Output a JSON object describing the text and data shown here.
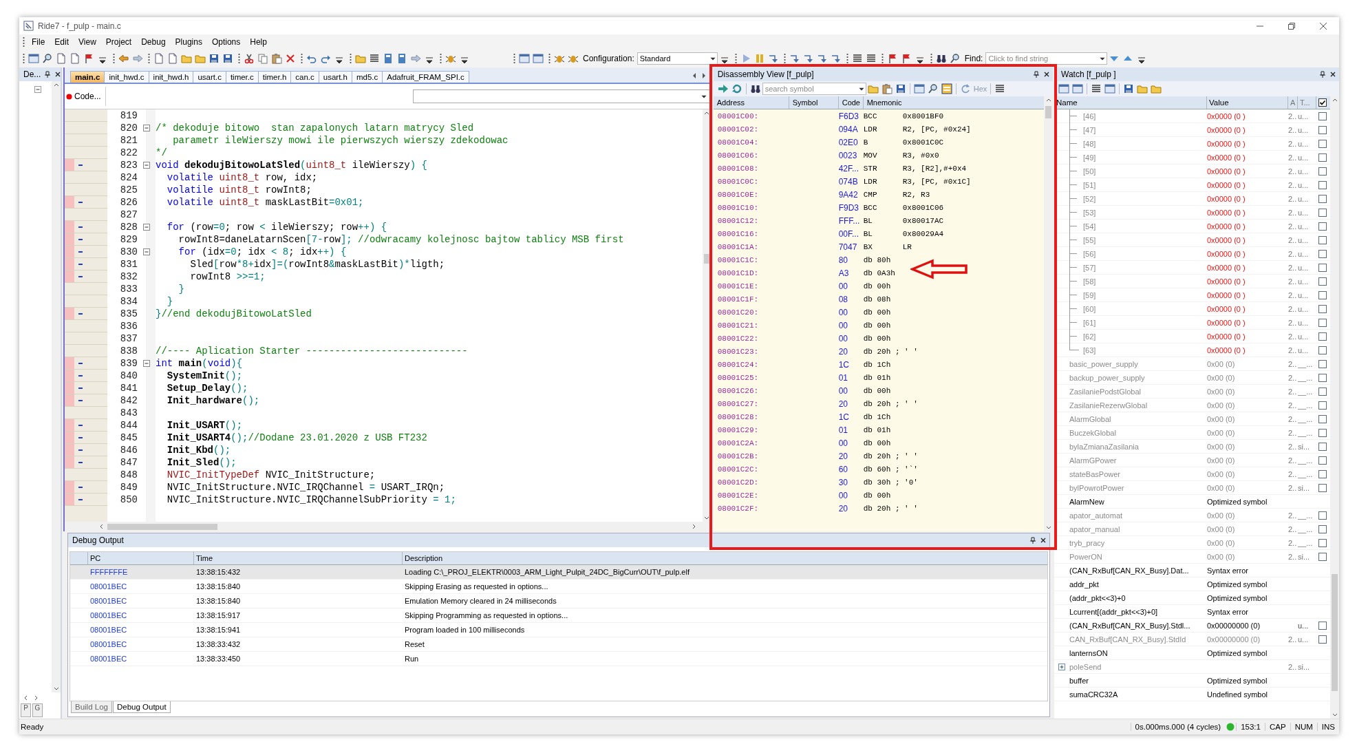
{
  "window": {
    "title": "Ride7 - f_pulp - main.c"
  },
  "menu": [
    "File",
    "Edit",
    "View",
    "Project",
    "Debug",
    "Plugins",
    "Options",
    "Help"
  ],
  "toolbar": {
    "configuration_label": "Configuration:",
    "configuration": "Standard",
    "find_label": "Find:",
    "find_placeholder": "Click to find string"
  },
  "left_panel": {
    "title": "De...",
    "tabs": [
      "P",
      "G"
    ]
  },
  "editor": {
    "tabs": [
      {
        "label": "main.c",
        "selected": true
      },
      {
        "label": "init_hwd.c",
        "selected": false
      },
      {
        "label": "init_hwd.h",
        "selected": false
      },
      {
        "label": "usart.c",
        "selected": false
      },
      {
        "label": "timer.c",
        "selected": false
      },
      {
        "label": "timer.h",
        "selected": false
      },
      {
        "label": "can.c",
        "selected": false
      },
      {
        "label": "usart.h",
        "selected": false
      },
      {
        "label": "md5.c",
        "selected": false
      },
      {
        "label": "Adafruit_FRAM_SPI.c",
        "selected": false
      }
    ],
    "code_button": "Code...",
    "lines": [
      {
        "n": "819",
        "fold": false,
        "exec": false
      },
      {
        "n": "820",
        "fold": true,
        "exec": false,
        "t": [
          {
            "kind": "comment",
            "text": "/* dekoduje bitowo  stan zapalonych latarn matrycy Sled"
          }
        ]
      },
      {
        "n": "821",
        "fold": false,
        "exec": false,
        "t": [
          {
            "kind": "comment",
            "text": "   parametr ileWierszy mowi ile pierwszych wierszy zdekodowac"
          }
        ]
      },
      {
        "n": "822",
        "fold": false,
        "exec": false,
        "t": [
          {
            "kind": "comment",
            "text": "*/"
          }
        ]
      },
      {
        "n": "823",
        "fold": true,
        "exec": true,
        "t": [
          {
            "kind": "keyword",
            "text": "void "
          },
          {
            "kind": "function",
            "text": "dekodujBitowoLatSled"
          },
          {
            "kind": "operator",
            "text": "("
          },
          {
            "kind": "type",
            "text": "uint8_t"
          },
          {
            "kind": "plain",
            "text": " ileWierszy"
          },
          {
            "kind": "operator",
            "text": ") {"
          }
        ]
      },
      {
        "n": "824",
        "fold": false,
        "exec": false,
        "t": [
          {
            "kind": "keyword",
            "text": "  volatile "
          },
          {
            "kind": "type",
            "text": "uint8_t"
          },
          {
            "kind": "plain",
            "text": " row, idx;"
          }
        ]
      },
      {
        "n": "825",
        "fold": false,
        "exec": false,
        "t": [
          {
            "kind": "keyword",
            "text": "  volatile "
          },
          {
            "kind": "type",
            "text": "uint8_t"
          },
          {
            "kind": "plain",
            "text": " rowInt8;"
          }
        ]
      },
      {
        "n": "826",
        "fold": false,
        "exec": true,
        "t": [
          {
            "kind": "keyword",
            "text": "  volatile "
          },
          {
            "kind": "type",
            "text": "uint8_t"
          },
          {
            "kind": "plain",
            "text": " maskLastBit"
          },
          {
            "kind": "operator",
            "text": "=0x01;"
          }
        ]
      },
      {
        "n": "827",
        "fold": false,
        "exec": false
      },
      {
        "n": "828",
        "fold": true,
        "exec": true,
        "t": [
          {
            "kind": "keyword",
            "text": "  for"
          },
          {
            "kind": "plain",
            "text": " (row"
          },
          {
            "kind": "operator",
            "text": "=0"
          },
          {
            "kind": "plain",
            "text": "; row "
          },
          {
            "kind": "operator",
            "text": "<"
          },
          {
            "kind": "plain",
            "text": " ileWierszy; row"
          },
          {
            "kind": "operator",
            "text": "++) {"
          }
        ]
      },
      {
        "n": "829",
        "fold": false,
        "exec": true,
        "t": [
          {
            "kind": "plain",
            "text": "    rowInt8=daneLatarnScen"
          },
          {
            "kind": "operator",
            "text": "[7-"
          },
          {
            "kind": "plain",
            "text": "row"
          },
          {
            "kind": "operator",
            "text": "];"
          },
          {
            "kind": "comment",
            "text": " //odwracamy kolejnosc bajtow tablicy MSB first"
          }
        ]
      },
      {
        "n": "830",
        "fold": true,
        "exec": true,
        "t": [
          {
            "kind": "keyword",
            "text": "    for"
          },
          {
            "kind": "plain",
            "text": " (idx"
          },
          {
            "kind": "operator",
            "text": "=0"
          },
          {
            "kind": "plain",
            "text": "; idx "
          },
          {
            "kind": "operator",
            "text": "< 8"
          },
          {
            "kind": "plain",
            "text": "; idx"
          },
          {
            "kind": "operator",
            "text": "++) {"
          }
        ]
      },
      {
        "n": "831",
        "fold": false,
        "exec": true,
        "t": [
          {
            "kind": "plain",
            "text": "      Sled"
          },
          {
            "kind": "operator",
            "text": "["
          },
          {
            "kind": "plain",
            "text": "row"
          },
          {
            "kind": "operator",
            "text": "*8+"
          },
          {
            "kind": "plain",
            "text": "idx"
          },
          {
            "kind": "operator",
            "text": "]=("
          },
          {
            "kind": "plain",
            "text": "rowInt8"
          },
          {
            "kind": "operator",
            "text": "&"
          },
          {
            "kind": "plain",
            "text": "maskLastBit"
          },
          {
            "kind": "operator",
            "text": ")*"
          },
          {
            "kind": "plain",
            "text": "ligth;"
          }
        ]
      },
      {
        "n": "832",
        "fold": false,
        "exec": true,
        "t": [
          {
            "kind": "plain",
            "text": "      rowInt8 "
          },
          {
            "kind": "operator",
            "text": ">>=1;"
          }
        ]
      },
      {
        "n": "833",
        "fold": false,
        "exec": false,
        "t": [
          {
            "kind": "operator",
            "text": "    }"
          }
        ]
      },
      {
        "n": "834",
        "fold": false,
        "exec": false,
        "t": [
          {
            "kind": "operator",
            "text": "  }"
          }
        ]
      },
      {
        "n": "835",
        "fold": false,
        "exec": true,
        "t": [
          {
            "kind": "operator",
            "text": "}"
          },
          {
            "kind": "comment",
            "text": "//end dekodujBitowoLatSled"
          }
        ]
      },
      {
        "n": "836",
        "fold": false,
        "exec": false
      },
      {
        "n": "837",
        "fold": false,
        "exec": false
      },
      {
        "n": "838",
        "fold": false,
        "exec": false,
        "t": [
          {
            "kind": "comment",
            "text": "//---- Aplication Starter ----------------------------"
          }
        ]
      },
      {
        "n": "839",
        "fold": true,
        "exec": true,
        "t": [
          {
            "kind": "keyword",
            "text": "int "
          },
          {
            "kind": "function",
            "text": "main"
          },
          {
            "kind": "operator",
            "text": "("
          },
          {
            "kind": "keyword",
            "text": "void"
          },
          {
            "kind": "operator",
            "text": "){"
          }
        ]
      },
      {
        "n": "840",
        "fold": false,
        "exec": true,
        "t": [
          {
            "kind": "function",
            "text": "  SystemInit"
          },
          {
            "kind": "operator",
            "text": "();"
          }
        ]
      },
      {
        "n": "841",
        "fold": false,
        "exec": true,
        "t": [
          {
            "kind": "function",
            "text": "  Setup_Delay"
          },
          {
            "kind": "operator",
            "text": "();"
          }
        ]
      },
      {
        "n": "842",
        "fold": false,
        "exec": true,
        "t": [
          {
            "kind": "function",
            "text": "  Init_hardware"
          },
          {
            "kind": "operator",
            "text": "();"
          }
        ]
      },
      {
        "n": "843",
        "fold": false,
        "exec": false
      },
      {
        "n": "844",
        "fold": false,
        "exec": true,
        "t": [
          {
            "kind": "function",
            "text": "  Init_USART"
          },
          {
            "kind": "operator",
            "text": "();"
          }
        ]
      },
      {
        "n": "845",
        "fold": false,
        "exec": true,
        "t": [
          {
            "kind": "function",
            "text": "  Init_USART4"
          },
          {
            "kind": "operator",
            "text": "();"
          },
          {
            "kind": "comment",
            "text": "//Dodane 23.01.2020 z USB FT232"
          }
        ]
      },
      {
        "n": "846",
        "fold": false,
        "exec": true,
        "t": [
          {
            "kind": "function",
            "text": "  Init_Kbd"
          },
          {
            "kind": "operator",
            "text": "();"
          }
        ]
      },
      {
        "n": "847",
        "fold": false,
        "exec": true,
        "t": [
          {
            "kind": "function",
            "text": "  Init_Sled"
          },
          {
            "kind": "operator",
            "text": "();"
          }
        ]
      },
      {
        "n": "848",
        "fold": false,
        "exec": false,
        "t": [
          {
            "kind": "type",
            "text": "  NVIC_InitTypeDef"
          },
          {
            "kind": "plain",
            "text": " NVIC_InitStructure;"
          }
        ]
      },
      {
        "n": "849",
        "fold": false,
        "exec": true,
        "t": [
          {
            "kind": "plain",
            "text": "  NVIC_InitStructure.NVIC_IRQChannel "
          },
          {
            "kind": "operator",
            "text": "="
          },
          {
            "kind": "plain",
            "text": " USART_IRQn;"
          }
        ]
      },
      {
        "n": "850",
        "fold": false,
        "exec": true,
        "t": [
          {
            "kind": "plain",
            "text": "  NVIC_InitStructure.NVIC_IRQChannelSubPriority "
          },
          {
            "kind": "operator",
            "text": "= 1;"
          }
        ]
      }
    ]
  },
  "disassembly": {
    "title": "Disassembly View [f_pulp]",
    "search_placeholder": "search symbol",
    "hex_label": "Hex",
    "columns": [
      "Address",
      "Symbol",
      "Code",
      "Mnemonic"
    ],
    "rows": [
      {
        "address": "08001C00:",
        "code": "F6D3",
        "mnemonic": "BCC",
        "operand": "0x8001BF0"
      },
      {
        "address": "08001C02:",
        "code": "094A",
        "mnemonic": "LDR",
        "operand": "R2, [PC, #0x24]"
      },
      {
        "address": "08001C04:",
        "code": "02E0",
        "mnemonic": "B",
        "operand": "0x8001C0C"
      },
      {
        "address": "08001C06:",
        "code": "0023",
        "mnemonic": "MOV",
        "operand": "R3, #0x0"
      },
      {
        "address": "08001C08:",
        "code": "42F...",
        "mnemonic": "STR",
        "operand": "R3, [R2],#+0x4"
      },
      {
        "address": "08001C0C:",
        "code": "074B",
        "mnemonic": "LDR",
        "operand": "R3, [PC, #0x1C]"
      },
      {
        "address": "08001C0E:",
        "code": "9A42",
        "mnemonic": "CMP",
        "operand": "R2, R3"
      },
      {
        "address": "08001C10:",
        "code": "F9D3",
        "mnemonic": "BCC",
        "operand": "0x8001C06"
      },
      {
        "address": "08001C12:",
        "code": "FFF...",
        "mnemonic": "BL",
        "operand": "0x80017AC"
      },
      {
        "address": "08001C16:",
        "code": "00F...",
        "mnemonic": "BL",
        "operand": "0x80029A4"
      },
      {
        "address": "08001C1A:",
        "code": "7047",
        "mnemonic": "BX",
        "operand": "LR"
      },
      {
        "address": "08001C1C:",
        "code": "80",
        "mnemonic": "db 80h"
      },
      {
        "address": "08001C1D:",
        "code": "A3",
        "mnemonic": "db 0A3h"
      },
      {
        "address": "08001C1E:",
        "code": "00",
        "mnemonic": "db 00h"
      },
      {
        "address": "08001C1F:",
        "code": "08",
        "mnemonic": "db 08h"
      },
      {
        "address": "08001C20:",
        "code": "00",
        "mnemonic": "db 00h"
      },
      {
        "address": "08001C21:",
        "code": "00",
        "mnemonic": "db 00h"
      },
      {
        "address": "08001C22:",
        "code": "00",
        "mnemonic": "db 00h"
      },
      {
        "address": "08001C23:",
        "code": "20",
        "mnemonic": "db 20h ; ' '"
      },
      {
        "address": "08001C24:",
        "code": "1C",
        "mnemonic": "db 1Ch"
      },
      {
        "address": "08001C25:",
        "code": "01",
        "mnemonic": "db 01h"
      },
      {
        "address": "08001C26:",
        "code": "00",
        "mnemonic": "db 00h"
      },
      {
        "address": "08001C27:",
        "code": "20",
        "mnemonic": "db 20h ; ' '"
      },
      {
        "address": "08001C28:",
        "code": "1C",
        "mnemonic": "db 1Ch"
      },
      {
        "address": "08001C29:",
        "code": "01",
        "mnemonic": "db 01h"
      },
      {
        "address": "08001C2A:",
        "code": "00",
        "mnemonic": "db 00h"
      },
      {
        "address": "08001C2B:",
        "code": "20",
        "mnemonic": "db 20h ; ' '"
      },
      {
        "address": "08001C2C:",
        "code": "60",
        "mnemonic": "db 60h ; '`'"
      },
      {
        "address": "08001C2D:",
        "code": "30",
        "mnemonic": "db 30h ; '0'"
      },
      {
        "address": "08001C2E:",
        "code": "00",
        "mnemonic": "db 00h"
      },
      {
        "address": "08001C2F:",
        "code": "20",
        "mnemonic": "db 20h ; ' '"
      }
    ]
  },
  "watch": {
    "title": "Watch [f_pulp ]",
    "columns": [
      "Name",
      "Value",
      "A",
      "T..."
    ],
    "header_checked": true,
    "rows": [
      {
        "kind": "element",
        "name": "[46]",
        "value": "0x0000 (0 )",
        "a": "2..",
        "t": "u...",
        "checked": false
      },
      {
        "kind": "element",
        "name": "[47]",
        "value": "0x0000 (0 )",
        "a": "2..",
        "t": "u...",
        "checked": false
      },
      {
        "kind": "element",
        "name": "[48]",
        "value": "0x0000 (0 )",
        "a": "2..",
        "t": "u...",
        "checked": false
      },
      {
        "kind": "element",
        "name": "[49]",
        "value": "0x0000 (0 )",
        "a": "2..",
        "t": "u...",
        "checked": false
      },
      {
        "kind": "element",
        "name": "[50]",
        "value": "0x0000 (0 )",
        "a": "2..",
        "t": "u...",
        "checked": false
      },
      {
        "kind": "element",
        "name": "[51]",
        "value": "0x0000 (0 )",
        "a": "2..",
        "t": "u...",
        "checked": false
      },
      {
        "kind": "element",
        "name": "[52]",
        "value": "0x0000 (0 )",
        "a": "2..",
        "t": "u...",
        "checked": false
      },
      {
        "kind": "element",
        "name": "[53]",
        "value": "0x0000 (0 )",
        "a": "2..",
        "t": "u...",
        "checked": false
      },
      {
        "kind": "element",
        "name": "[54]",
        "value": "0x0000 (0 )",
        "a": "2..",
        "t": "u...",
        "checked": false
      },
      {
        "kind": "element",
        "name": "[55]",
        "value": "0x0000 (0 )",
        "a": "2..",
        "t": "u...",
        "checked": false
      },
      {
        "kind": "element",
        "name": "[56]",
        "value": "0x0000 (0 )",
        "a": "2..",
        "t": "u...",
        "checked": false
      },
      {
        "kind": "element",
        "name": "[57]",
        "value": "0x0000 (0 )",
        "a": "2..",
        "t": "u...",
        "checked": false
      },
      {
        "kind": "element",
        "name": "[58]",
        "value": "0x0000 (0 )",
        "a": "2..",
        "t": "u...",
        "checked": false
      },
      {
        "kind": "element",
        "name": "[59]",
        "value": "0x0000 (0 )",
        "a": "2..",
        "t": "u...",
        "checked": false
      },
      {
        "kind": "element",
        "name": "[60]",
        "value": "0x0000 (0 )",
        "a": "2..",
        "t": "u...",
        "checked": false
      },
      {
        "kind": "element",
        "name": "[61]",
        "value": "0x0000 (0 )",
        "a": "2..",
        "t": "u...",
        "checked": false
      },
      {
        "kind": "element",
        "name": "[62]",
        "value": "0x0000 (0 )",
        "a": "2..",
        "t": "u...",
        "checked": false
      },
      {
        "kind": "lastelement",
        "name": "[63]",
        "value": "0x0000 (0 )",
        "a": "2..",
        "t": "u...",
        "checked": false
      },
      {
        "kind": "inactive",
        "name": "basic_power_supply",
        "value": "0x00 (0)",
        "a": "2..",
        "t": "__...",
        "checked": false
      },
      {
        "kind": "inactive",
        "name": "backup_power_supply",
        "value": "0x00 (0)",
        "a": "2..",
        "t": "__...",
        "checked": false
      },
      {
        "kind": "inactive",
        "name": "ZasilaniePodstGlobal",
        "value": "0x00 (0)",
        "a": "2..",
        "t": "__...",
        "checked": false
      },
      {
        "kind": "inactive",
        "name": "ZasilanieRezerwGlobal",
        "value": "0x00 (0)",
        "a": "2..",
        "t": "__...",
        "checked": false
      },
      {
        "kind": "inactive",
        "name": "AlarmGlobal",
        "value": "0x00 (0)",
        "a": "2..",
        "t": "__...",
        "checked": false
      },
      {
        "kind": "inactive",
        "name": "BuczekGlobal",
        "value": "0x00 (0)",
        "a": "2..",
        "t": "__...",
        "checked": false
      },
      {
        "kind": "inactive",
        "name": "bylaZmianaZasilania",
        "value": "0x00 (0)",
        "a": "2..",
        "t": "si...",
        "checked": false
      },
      {
        "kind": "inactive",
        "name": "AlarmGPower",
        "value": "0x00 (0)",
        "a": "2..",
        "t": "__...",
        "checked": false
      },
      {
        "kind": "inactive",
        "name": "stateBasPower",
        "value": "0x00 (0)",
        "a": "2..",
        "t": "__...",
        "checked": false
      },
      {
        "kind": "inactive",
        "name": "bylPowrotPower",
        "value": "0x00 (0)",
        "a": "2..",
        "t": "si...",
        "checked": false
      },
      {
        "kind": "plain",
        "name": "AlarmNew",
        "value": "Optimized symbol"
      },
      {
        "kind": "inactive",
        "name": "apator_automat",
        "value": "0x00 (0)",
        "a": "2..",
        "t": "__...",
        "checked": false
      },
      {
        "kind": "inactive",
        "name": "apator_manual",
        "value": "0x00 (0)",
        "a": "2..",
        "t": "__...",
        "checked": false
      },
      {
        "kind": "inactive",
        "name": "tryb_pracy",
        "value": "0x00 (0)",
        "a": "2..",
        "t": "__...",
        "checked": false
      },
      {
        "kind": "inactive",
        "name": "PowerON",
        "value": "0x00 (0)",
        "a": "2..",
        "t": "si...",
        "checked": false
      },
      {
        "kind": "plain",
        "name": "(CAN_RxBuf[CAN_RX_Busy].Dat...",
        "value": "Syntax error"
      },
      {
        "kind": "plain",
        "name": "addr_pkt",
        "value": "Optimized symbol"
      },
      {
        "kind": "plain",
        "name": "(addr_pkt<<3)+0",
        "value": "Optimized symbol"
      },
      {
        "kind": "plain",
        "name": "Lcurrent[(addr_pkt<<3)+0]",
        "value": "Syntax error"
      },
      {
        "kind": "plain",
        "name": "(CAN_RxBuf[CAN_RX_Busy].Stdl...",
        "value": "0x00000000 (0)",
        "t": "u...",
        "checked": false
      },
      {
        "kind": "inactive",
        "name": "CAN_RxBuf[CAN_RX_Busy].StdId",
        "value": "0x00000000 (0)",
        "a": "2..",
        "t": "u...",
        "checked": false
      },
      {
        "kind": "plain",
        "name": "lanternsON",
        "value": "Optimized symbol"
      },
      {
        "kind": "expandable",
        "name": "poleSend",
        "a": "2..",
        "t": "si..."
      },
      {
        "kind": "plain",
        "name": "buffer",
        "value": "Optimized symbol"
      },
      {
        "kind": "plain",
        "name": "sumaCRC32A",
        "value": "Undefined symbol"
      }
    ]
  },
  "debug_output": {
    "title": "Debug Output",
    "columns": [
      "PC",
      "Time",
      "Description"
    ],
    "rows": [
      {
        "pc": "FFFFFFFE",
        "time": "13:38:15:432",
        "description": "Loading C:\\_PROJ_ELEKTR\\0003_ARM_Light_Pulpit_24DC_BigCurr\\OUT\\f_pulp.elf",
        "selected": true
      },
      {
        "pc": "08001BEC",
        "time": "13:38:15:840",
        "description": "Skipping Erasing as requested in options...",
        "selected": false
      },
      {
        "pc": "08001BEC",
        "time": "13:38:15:840",
        "description": "Emulation Memory cleared in 24 milliseconds",
        "selected": false
      },
      {
        "pc": "08001BEC",
        "time": "13:38:15:917",
        "description": "Skipping Programming as requested in options...",
        "selected": false
      },
      {
        "pc": "08001BEC",
        "time": "13:38:15:941",
        "description": "Program loaded in 100 milliseconds",
        "selected": false
      },
      {
        "pc": "08001BEC",
        "time": "13:38:33:432",
        "description": "Reset",
        "selected": false
      },
      {
        "pc": "08001BEC",
        "time": "13:38:33:450",
        "description": "Run",
        "selected": false
      }
    ],
    "tabs": [
      {
        "label": "Build Log",
        "selected": false
      },
      {
        "label": "Debug Output",
        "selected": true
      }
    ]
  },
  "status_bar": {
    "text": "Ready",
    "timing": "0s.000ms.000 (4 cycles)",
    "position": "153:1",
    "indicators": [
      "CAP",
      "NUM",
      "INS"
    ]
  }
}
